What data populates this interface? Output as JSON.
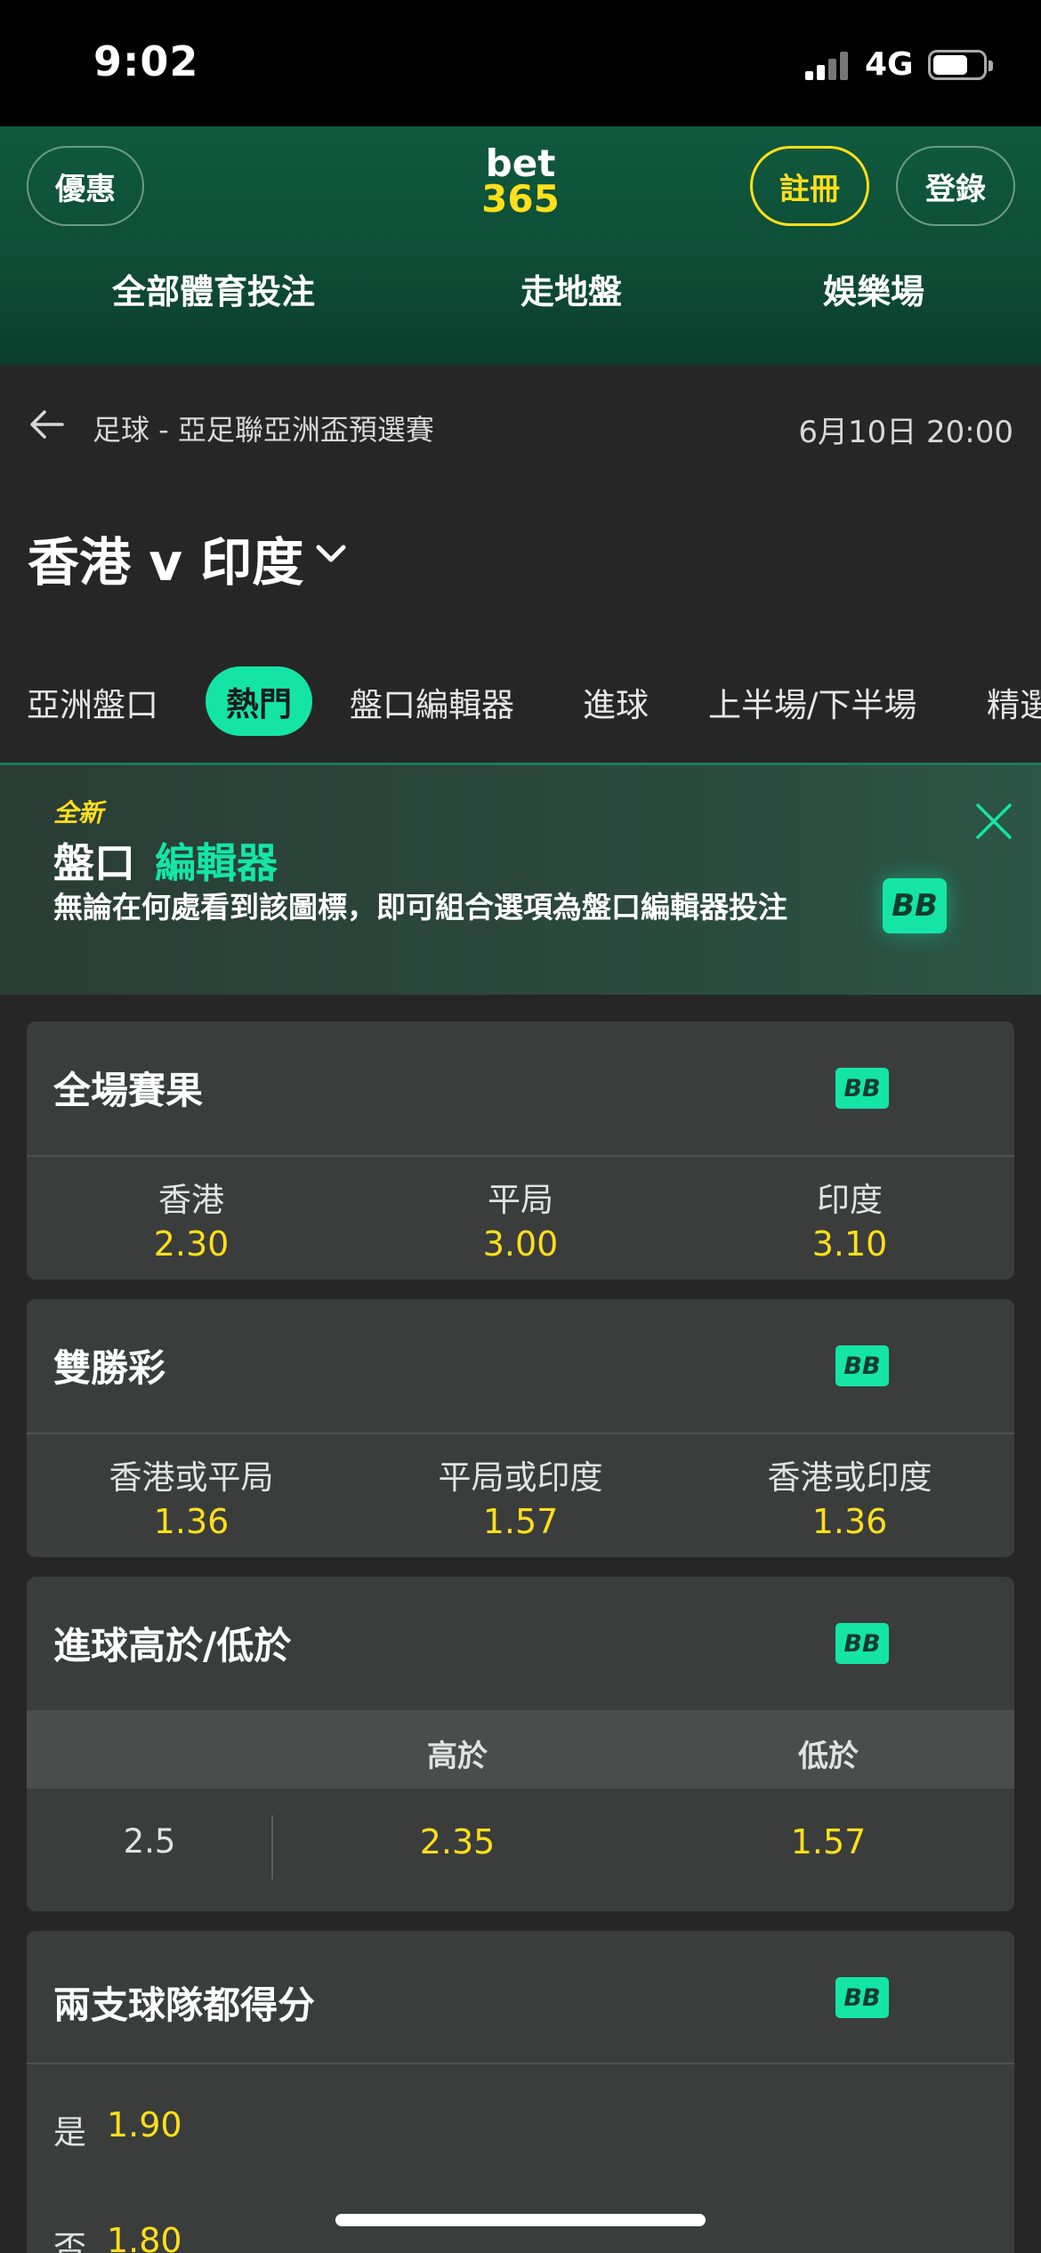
{
  "status": {
    "time": "9:02",
    "network": "4G"
  },
  "header": {
    "promo_label": "優惠",
    "logo_top": "bet",
    "logo_bottom": "365",
    "register_label": "註冊",
    "login_label": "登錄",
    "nav": [
      "全部體育投注",
      "走地盤",
      "娛樂場"
    ]
  },
  "breadcrumb": {
    "text": "足球 - 亞足聯亞洲盃預選賽",
    "datetime": "6月10日 20:00"
  },
  "match": {
    "title": "香港 v 印度"
  },
  "tabs": {
    "items": [
      "亞洲盤口",
      "熱門",
      "盤口編輯器",
      "進球",
      "上半場/下半場",
      "精選"
    ],
    "active_index": 1
  },
  "banner": {
    "new_label": "全新",
    "title_part1": "盤口",
    "title_part2": "編輯器",
    "description": "無論在何處看到該圖標，即可組合選項為盤口編輯器投注",
    "badge": "BB"
  },
  "markets": {
    "full_time": {
      "title": "全場賽果",
      "badge": "BB",
      "selections": [
        {
          "label": "香港",
          "odds": "2.30"
        },
        {
          "label": "平局",
          "odds": "3.00"
        },
        {
          "label": "印度",
          "odds": "3.10"
        }
      ]
    },
    "double_chance": {
      "title": "雙勝彩",
      "badge": "BB",
      "selections": [
        {
          "label": "香港或平局",
          "odds": "1.36"
        },
        {
          "label": "平局或印度",
          "odds": "1.57"
        },
        {
          "label": "香港或印度",
          "odds": "1.36"
        }
      ]
    },
    "over_under": {
      "title": "進球高於/低於",
      "badge": "BB",
      "over_label": "高於",
      "under_label": "低於",
      "line": "2.5",
      "over_odds": "2.35",
      "under_odds": "1.57"
    },
    "both_score": {
      "title": "兩支球隊都得分",
      "badge": "BB",
      "yes_label": "是",
      "yes_odds": "1.90",
      "no_label": "否",
      "no_odds": "1.80"
    }
  },
  "colors": {
    "accent_green": "#14e5a6",
    "odds_yellow": "#ffdf1b",
    "header_green": "#0f5a3e"
  }
}
